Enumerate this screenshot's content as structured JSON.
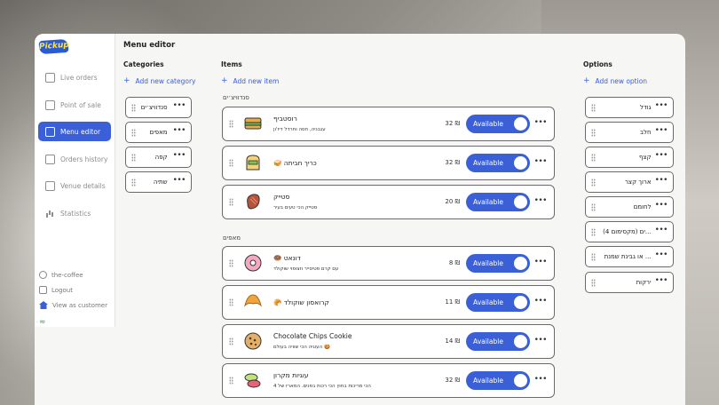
{
  "sidebar": {
    "logo": "Pickup",
    "nav": [
      {
        "label": "Live orders",
        "icon": "orders-icon",
        "active": false
      },
      {
        "label": "Point of sale",
        "icon": "pos-icon",
        "active": false
      },
      {
        "label": "Menu editor",
        "icon": "menu-icon",
        "active": true
      },
      {
        "label": "Orders history",
        "icon": "history-icon",
        "active": false
      },
      {
        "label": "Venue details",
        "icon": "venue-icon",
        "active": false
      },
      {
        "label": "Statistics",
        "icon": "chart-icon",
        "active": false
      }
    ],
    "venue": "the-coffee",
    "logout": "Logout",
    "view_as_customer": "View as customer"
  },
  "page": {
    "title": "Menu editor"
  },
  "categories": {
    "title": "Categories",
    "add_label": "Add new category",
    "items": [
      "סנדוויצ׳ים",
      "מאפים",
      "קפה",
      "שתיה"
    ]
  },
  "items": {
    "title": "Items",
    "add_label": "Add new item",
    "sections": [
      {
        "name": "סנדוויצ׳ים",
        "rows": [
          {
            "name": "רוסטביף",
            "desc": "עגבניה, חסה וחרדל דיז'ון",
            "price": "32 ₪",
            "status": "Available",
            "thumb": "sandwich"
          },
          {
            "name": "🥪 כריך חביתה",
            "desc": "",
            "price": "32 ₪",
            "status": "Available",
            "thumb": "toast"
          },
          {
            "name": "סטייק",
            "desc": "סטייק הכי טעים בעיר",
            "price": "20 ₪",
            "status": "Available",
            "thumb": "steak"
          }
        ]
      },
      {
        "name": "מאפים",
        "rows": [
          {
            "name": "🍩 דונאט",
            "desc": "עם קרם פטיסייר וזצופוי שוקולד",
            "price": "8 ₪",
            "status": "Available",
            "thumb": "donut"
          },
          {
            "name": "🥐 קרואסון שוקולד",
            "desc": "",
            "price": "11 ₪",
            "status": "Available",
            "thumb": "croissant"
          },
          {
            "name": "Chocolate Chips Cookie",
            "desc": "העוגיה הכי שוויה בעולם 🍪",
            "price": "14 ₪",
            "status": "Available",
            "thumb": "cookie"
          },
          {
            "name": "עוגיות מקרון",
            "desc": "הכי מריכות בחוץ הכי רכות בפנים. המארז של 4",
            "price": "32 ₪",
            "status": "Available",
            "thumb": "macaron"
          }
        ]
      }
    ]
  },
  "options": {
    "title": "Options",
    "add_label": "Add new option",
    "items": [
      "גודל",
      "חלב",
      "קצף",
      "ארוך קצר",
      "לחומם",
      "...ים (מקסימום 4)",
      "... או גבינת שמנת",
      "ירקות"
    ]
  }
}
